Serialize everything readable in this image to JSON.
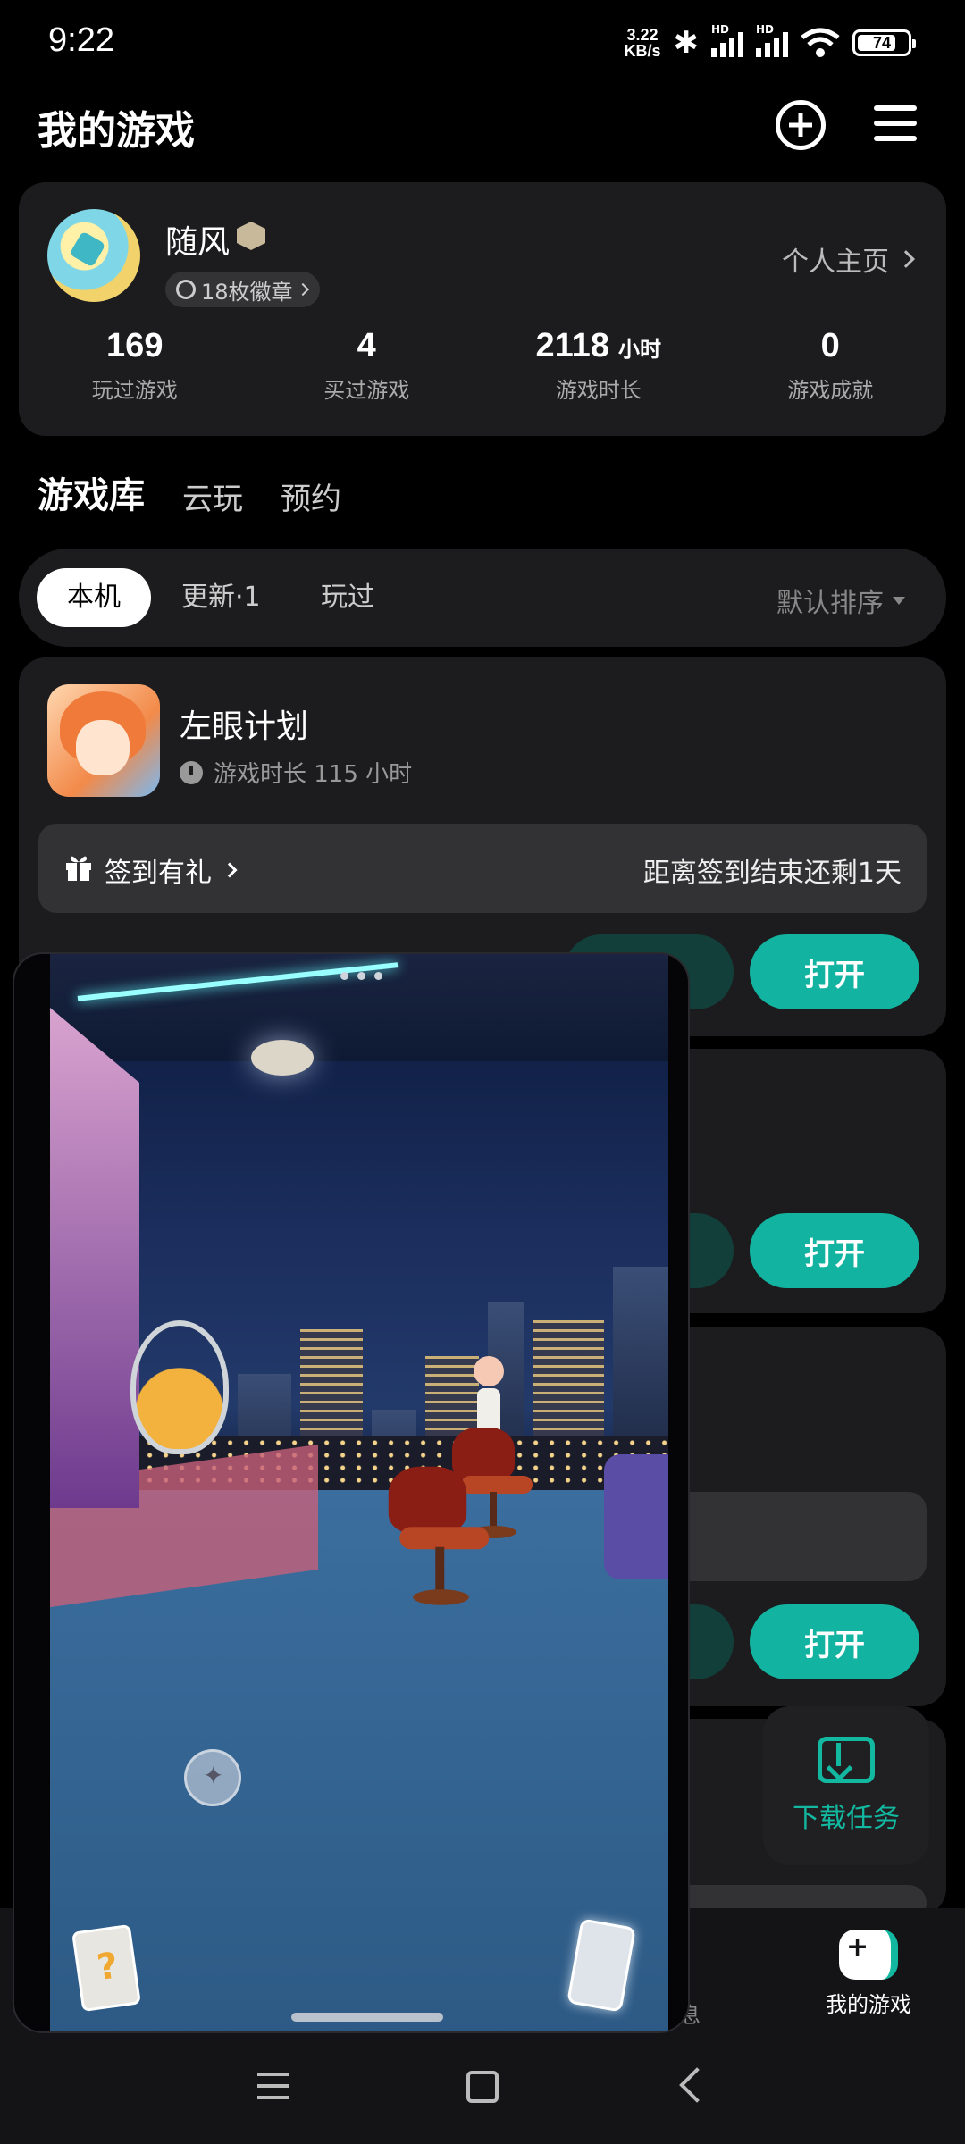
{
  "status_bar": {
    "time": "9:22",
    "net_speed_value": "3.22",
    "net_speed_unit": "KB/s",
    "hd_label": "HD",
    "battery": "74"
  },
  "header": {
    "title": "我的游戏"
  },
  "profile": {
    "username": "随风",
    "badges": "18枚徽章",
    "homepage_link": "个人主页",
    "stats": [
      {
        "value": "169",
        "unit": "",
        "label": "玩过游戏"
      },
      {
        "value": "4",
        "unit": "",
        "label": "买过游戏"
      },
      {
        "value": "2118",
        "unit": "小时",
        "label": "游戏时长"
      },
      {
        "value": "0",
        "unit": "",
        "label": "游戏成就"
      }
    ]
  },
  "main_tabs": [
    {
      "label": "游戏库",
      "active": true
    },
    {
      "label": "云玩",
      "active": false
    },
    {
      "label": "预约",
      "active": false
    }
  ],
  "filters": {
    "chips": [
      "本机",
      "更新·1",
      "玩过"
    ],
    "active": "本机",
    "sort": "默认排序"
  },
  "games": [
    {
      "title": "左眼计划",
      "playtime": "游戏时长 115 小时",
      "checkin_label": "签到有礼",
      "checkin_remaining": "距离签到结束还剩1天",
      "open_label": "打开"
    },
    {
      "open_label": "打开"
    },
    {
      "open_label": "打开"
    }
  ],
  "download_task": {
    "label": "下载任务"
  },
  "bottom_nav": {
    "partial_label": "息",
    "games_label": "我的游戏"
  },
  "colors": {
    "accent": "#13b8a1",
    "background": "#000000",
    "card": "#1c1c1e"
  }
}
